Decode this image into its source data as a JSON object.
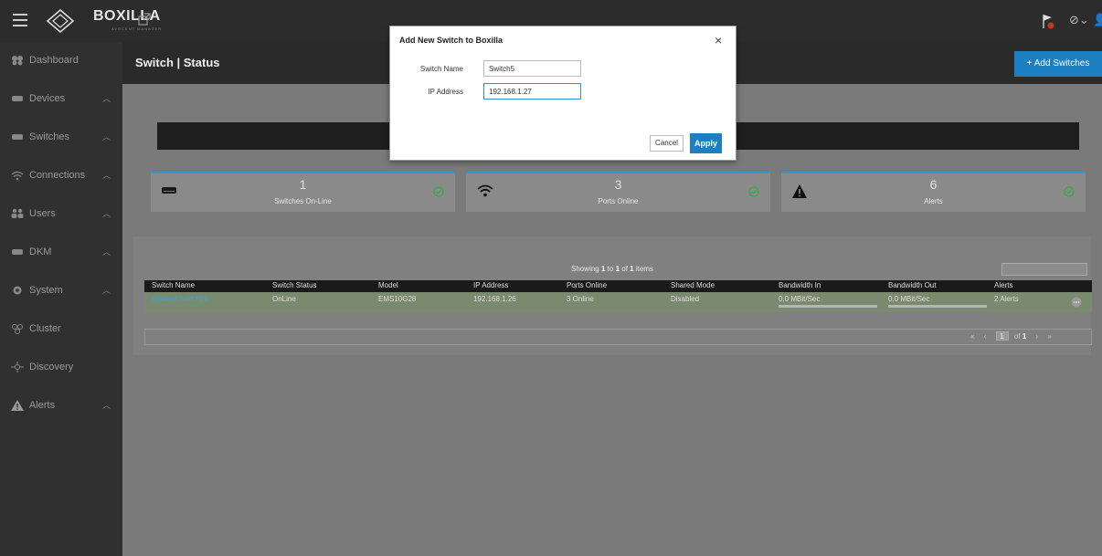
{
  "app": {
    "logo_text": "BOXILLA",
    "logo_sub": "AVOCENT MANAGER"
  },
  "sidebar": {
    "items": [
      {
        "label": "Dashboard",
        "icon": "dashboard-icon",
        "has_chevron": false
      },
      {
        "label": "Devices",
        "icon": "device-icon",
        "has_chevron": true
      },
      {
        "label": "Switches",
        "icon": "switch-icon",
        "has_chevron": true
      },
      {
        "label": "Connections",
        "icon": "wifi-icon",
        "has_chevron": true
      },
      {
        "label": "Users",
        "icon": "users-icon",
        "has_chevron": true
      },
      {
        "label": "DKM",
        "icon": "dkm-icon",
        "has_chevron": true
      },
      {
        "label": "System",
        "icon": "gear-icon",
        "has_chevron": true
      },
      {
        "label": "Cluster",
        "icon": "cluster-icon",
        "has_chevron": false
      },
      {
        "label": "Discovery",
        "icon": "discovery-icon",
        "has_chevron": false
      },
      {
        "label": "Alerts",
        "icon": "warning-icon",
        "has_chevron": true
      }
    ]
  },
  "header": {
    "title": "Switch | Status",
    "add_button": "+ Add Switches"
  },
  "stats": [
    {
      "value": "1",
      "caption": "Switches On-Line",
      "icon": "switch-icon"
    },
    {
      "value": "3",
      "caption": "Ports Online",
      "icon": "wifi-icon"
    },
    {
      "value": "6",
      "caption": "Alerts",
      "icon": "warning-icon"
    }
  ],
  "table": {
    "showing_prefix": "Showing ",
    "showing_from": "1",
    "showing_mid": " to ",
    "showing_to": "1",
    "showing_of": " of ",
    "showing_total": "1",
    "showing_suffix": " items",
    "columns": [
      "Switch Name",
      "Switch Status",
      "Model",
      "IP Address",
      "Ports Online",
      "Shared Mode",
      "Bandwidth In",
      "Bandwidth Out",
      "Alerts"
    ],
    "rows": [
      [
        "NetworkSwitch01",
        "OnLine",
        "EMS10G28",
        "192.168.1.26",
        "3 Online",
        "Disabled",
        "0.0 MBit/Sec",
        "0.0 MBit/Sec",
        "2 Alerts"
      ]
    ],
    "pager": {
      "first": "«",
      "prev": "‹",
      "page": "1",
      "of_label": "of",
      "total_pages": "1",
      "next": "›",
      "last": "»"
    }
  },
  "modal": {
    "title": "Add New Switch to Boxilla",
    "close": "×",
    "switch_name_label": "Switch Name",
    "switch_name_value": "Switch5",
    "ip_label": "IP Address",
    "ip_value": "192.168.1.27",
    "cancel": "Cancel",
    "apply": "Apply"
  },
  "colors": {
    "accent": "#1c7fc2",
    "ok": "#3aa84b",
    "alert": "#c0392b"
  }
}
